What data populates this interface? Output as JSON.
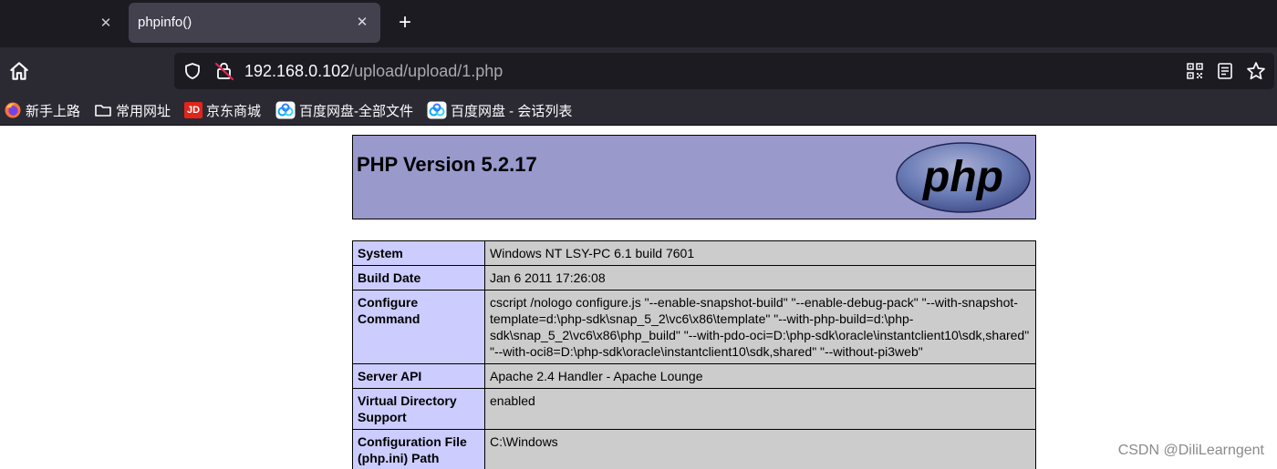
{
  "browser": {
    "tabs": [
      {
        "title": "phpinfo()",
        "active": true
      }
    ],
    "url": {
      "host": "192.168.0.102",
      "path": "/upload/upload/1.php"
    },
    "bookmarks": [
      {
        "label": "新手上路",
        "icon": "firefox-icon"
      },
      {
        "label": "常用网址",
        "icon": "folder-icon"
      },
      {
        "label": "京东商城",
        "icon": "jd-icon",
        "badge": "JD"
      },
      {
        "label": "百度网盘-全部文件",
        "icon": "baidu-netdisk-icon"
      },
      {
        "label": "百度网盘 - 会话列表",
        "icon": "baidu-netdisk-icon"
      }
    ],
    "colors": {
      "tabbar": "#1c1b22",
      "toolbar": "#2b2a33",
      "active_tab": "#42414d"
    }
  },
  "page": {
    "version_title": "PHP Version 5.2.17",
    "logo_text": "php",
    "colors": {
      "header": "#9999cc",
      "key_cell": "#ccccff",
      "value_cell": "#cccccc"
    },
    "rows": [
      {
        "key": "System",
        "value": "Windows NT LSY-PC 6.1 build 7601"
      },
      {
        "key": "Build Date",
        "value": "Jan 6 2011 17:26:08"
      },
      {
        "key": "Configure Command",
        "value": "cscript /nologo configure.js \"--enable-snapshot-build\" \"--enable-debug-pack\" \"--with-snapshot-template=d:\\php-sdk\\snap_5_2\\vc6\\x86\\template\" \"--with-php-build=d:\\php-sdk\\snap_5_2\\vc6\\x86\\php_build\" \"--with-pdo-oci=D:\\php-sdk\\oracle\\instantclient10\\sdk,shared\" \"--with-oci8=D:\\php-sdk\\oracle\\instantclient10\\sdk,shared\" \"--without-pi3web\""
      },
      {
        "key": "Server API",
        "value": "Apache 2.4 Handler - Apache Lounge"
      },
      {
        "key": "Virtual Directory Support",
        "value": "enabled"
      },
      {
        "key": "Configuration File (php.ini) Path",
        "value": "C:\\Windows"
      }
    ]
  },
  "watermark": "CSDN @DiliLearngent"
}
